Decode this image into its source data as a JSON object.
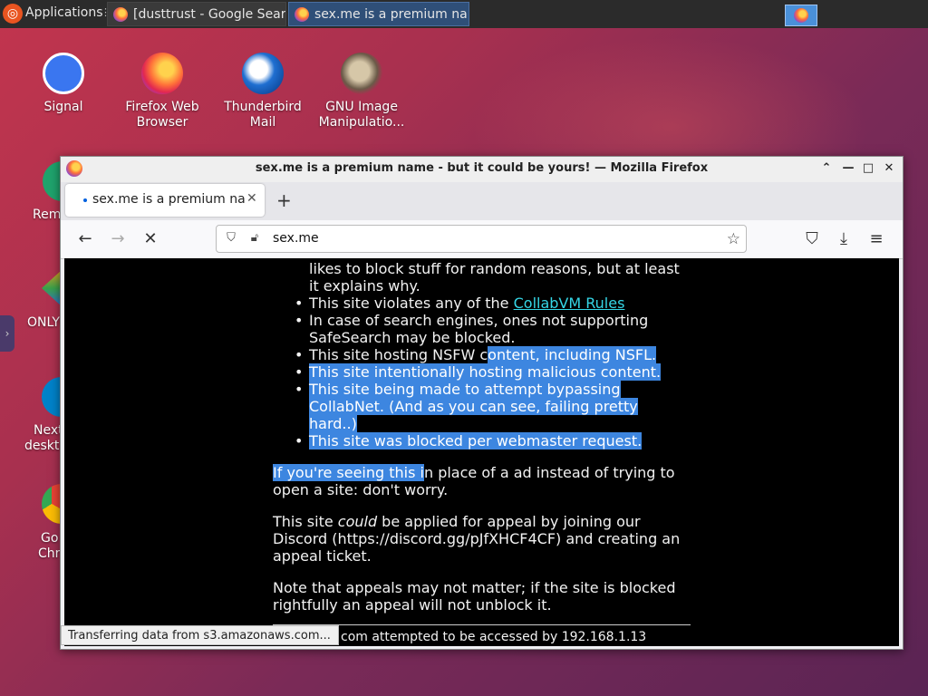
{
  "topbar": {
    "apps_label": "Applications",
    "tasks": [
      {
        "label": "[dusttrust - Google Sear...",
        "active": false
      },
      {
        "label": "sex.me is a premium na...",
        "active": true
      }
    ]
  },
  "desktop": {
    "icons": [
      {
        "label": "Signal",
        "icon": "signal-icon"
      },
      {
        "label": "Firefox Web Browser",
        "icon": "firefox-icon"
      },
      {
        "label": "Thunderbird Mail",
        "icon": "thunderbird-icon"
      },
      {
        "label": "GNU Image Manipulatio...",
        "icon": "gimp-icon"
      }
    ],
    "partial_labels": [
      "Rem",
      "ONLYO",
      "Next",
      "deskto",
      "Go",
      "Chr"
    ]
  },
  "window": {
    "title": "sex.me is a premium name - but it could be yours! — Mozilla Firefox",
    "tab_label": "sex.me is a premium name - but it could be yours!",
    "url": "sex.me"
  },
  "page": {
    "cont_lines": [
      "likes to block stuff for random reasons, but at least",
      "it explains why."
    ],
    "bullets": [
      {
        "pre": "This site violates any of the ",
        "link": "CollabVM Rules"
      },
      {
        "lines": [
          "In case of search engines, ones not supporting",
          "SafeSearch may be blocked."
        ]
      },
      {
        "plain": "This site hosting NSFW c",
        "highlight": "ontent, including NSFL."
      },
      {
        "highlight": "This site intentionally hosting malicious content."
      },
      {
        "highlight_lines": [
          "This site being made to attempt bypassing",
          "CollabNet. (And as you can see, failing pretty",
          "hard..)"
        ]
      },
      {
        "highlight": "This site was blocked per webmaster request."
      }
    ],
    "para1": {
      "highlight": "If you're seeing this i",
      "rest_line1": "n place of a ad instead of trying to",
      "line2": "open a site: don't worry."
    },
    "para2": {
      "pre": "This site ",
      "em": "could",
      "post": " be applied for appeal by joining our",
      "line2": "Discord (https://discord.gg/pJfXHCF4CF) and creating an",
      "line3": "appeal ticket."
    },
    "para3": {
      "line1": "Note that appeals may not matter; if the site is blocked",
      "line2": "rightfully an appeal will not unblock it."
    },
    "footer": "com attempted to be accessed by 192.168.1.13"
  },
  "status": "Transferring data from s3.amazonaws.com..."
}
